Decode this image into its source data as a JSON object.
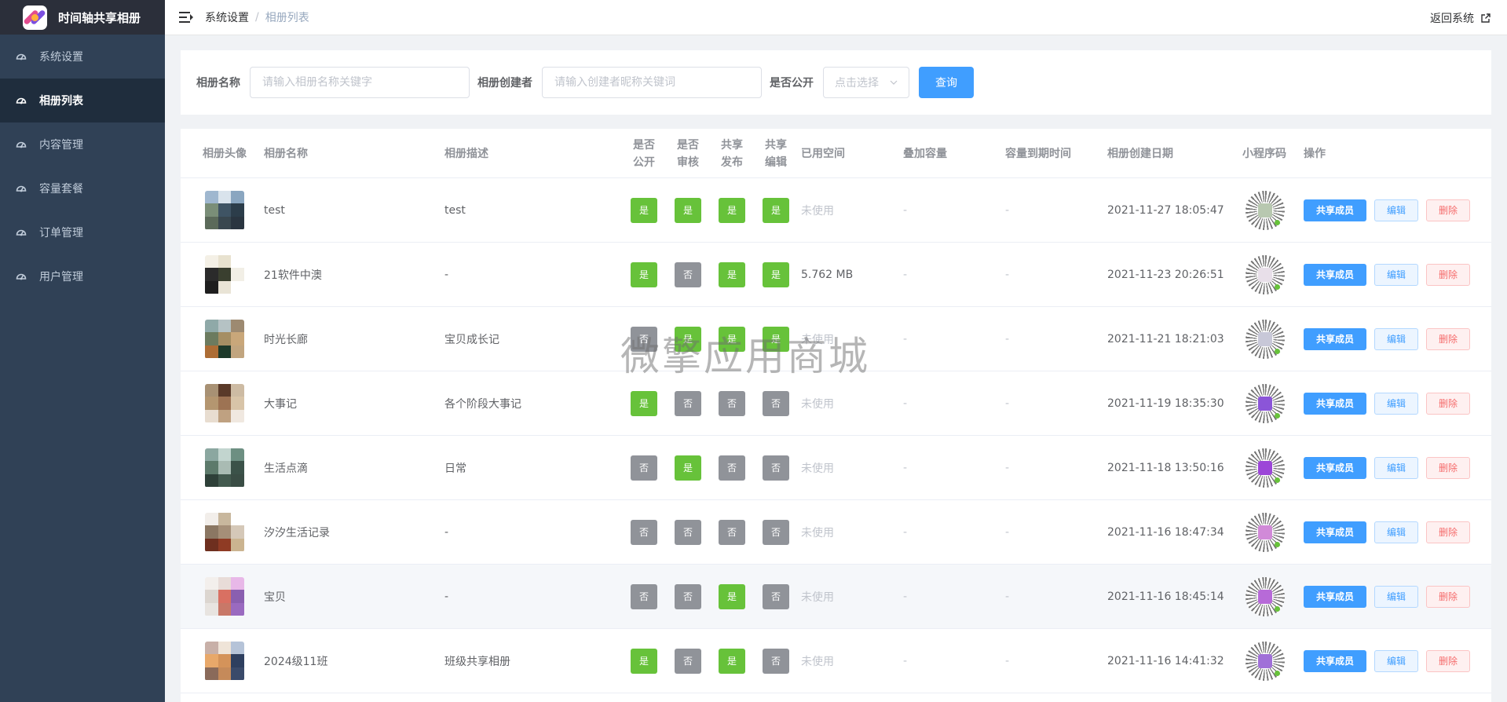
{
  "app": {
    "title": "时间轴共享相册"
  },
  "sidebar": {
    "items": [
      {
        "label": "系统设置",
        "icon": "dashboard-icon"
      },
      {
        "label": "相册列表",
        "icon": "dashboard-icon",
        "active": true
      },
      {
        "label": "内容管理",
        "icon": "dashboard-icon"
      },
      {
        "label": "容量套餐",
        "icon": "dashboard-icon"
      },
      {
        "label": "订单管理",
        "icon": "dashboard-icon"
      },
      {
        "label": "用户管理",
        "icon": "dashboard-icon"
      }
    ]
  },
  "header": {
    "breadcrumb": [
      "系统设置",
      "相册列表"
    ],
    "return_label": "返回系统"
  },
  "search": {
    "name_label": "相册名称",
    "name_placeholder": "请输入相册名称关键字",
    "creator_label": "相册创建者",
    "creator_placeholder": "请输入创建者昵称关键词",
    "public_label": "是否公开",
    "public_placeholder": "点击选择",
    "query_button": "查询"
  },
  "table": {
    "headers": {
      "avatar": "相册头像",
      "name": "相册名称",
      "desc": "相册描述",
      "public_1": "是否",
      "public_2": "公开",
      "review_1": "是否",
      "review_2": "审核",
      "share_pub_1": "共享",
      "share_pub_2": "发布",
      "share_edit_1": "共享",
      "share_edit_2": "编辑",
      "used": "已用空间",
      "extra": "叠加容量",
      "expire": "容量到期时间",
      "created": "相册创建日期",
      "qr": "小程序码",
      "ops": "操作"
    },
    "button_labels": {
      "share": "共享成员",
      "edit": "编辑",
      "delete": "删除"
    },
    "rows": [
      {
        "name": "test",
        "desc": "test",
        "public": "是",
        "review": "是",
        "share_pub": "是",
        "share_edit": "是",
        "used": "未使用",
        "extra": "-",
        "expire": "-",
        "created": "2021-11-27 18:05:47",
        "thumb_colors": [
          "#9fb7cf",
          "#d9e3ec",
          "#8aa6c0",
          "#7a8e78",
          "#3f5464",
          "#2c3d4a",
          "#5b6a5a",
          "#39474f",
          "#2a3540"
        ],
        "qr_center": "#b8c8b0"
      },
      {
        "name": "21软件中澳",
        "desc": "-",
        "public": "是",
        "review": "否",
        "share_pub": "是",
        "share_edit": "是",
        "used": "5.762 MB",
        "extra": "-",
        "expire": "-",
        "created": "2021-11-23 20:26:51",
        "thumb_colors": [
          "#f4f0e6",
          "#e8e2cf",
          "#ffffff",
          "#2b2b2b",
          "#3a3f2f",
          "#f2efe6",
          "#1e1e1e",
          "#e9e4d6",
          "#ffffff"
        ],
        "qr_center": "#e8dfe9"
      },
      {
        "name": "时光长廊",
        "desc": "宝贝成长记",
        "public": "否",
        "review": "是",
        "share_pub": "是",
        "share_edit": "是",
        "used": "未使用",
        "extra": "-",
        "expire": "-",
        "created": "2021-11-21 18:21:03",
        "thumb_colors": [
          "#8fa9a8",
          "#b5c2c4",
          "#9d8a71",
          "#6c7b5f",
          "#a58e63",
          "#c9a77a",
          "#ad6d35",
          "#1d3a2a",
          "#c1a57f"
        ],
        "qr_center": "#c8c8d8"
      },
      {
        "name": "大事记",
        "desc": "各个阶段大事记",
        "public": "是",
        "review": "否",
        "share_pub": "否",
        "share_edit": "否",
        "used": "未使用",
        "extra": "-",
        "expire": "-",
        "created": "2021-11-19 18:35:30",
        "thumb_colors": [
          "#a89174",
          "#5a3a29",
          "#cdbba3",
          "#b49670",
          "#9d7353",
          "#d8c4a8",
          "#e8ddd0",
          "#bfa181",
          "#f0e8e0"
        ],
        "qr_center": "#8b55d8"
      },
      {
        "name": "生活点滴",
        "desc": "日常",
        "public": "否",
        "review": "是",
        "share_pub": "否",
        "share_edit": "否",
        "used": "未使用",
        "extra": "-",
        "expire": "-",
        "created": "2021-11-18 13:50:16",
        "thumb_colors": [
          "#8ba7a0",
          "#c2d5cf",
          "#6d8f82",
          "#5d7a6b",
          "#a9bbb3",
          "#3b5249",
          "#2e4038",
          "#435a4f",
          "#3a4d45"
        ],
        "qr_center": "#9c46d8"
      },
      {
        "name": "汐汐生活记录",
        "desc": "-",
        "public": "否",
        "review": "否",
        "share_pub": "否",
        "share_edit": "否",
        "used": "未使用",
        "extra": "-",
        "expire": "-",
        "created": "2021-11-16 18:47:34",
        "thumb_colors": [
          "#f2eeea",
          "#c8b79d",
          "#ffffff",
          "#8b7763",
          "#a58f78",
          "#d5c8b8",
          "#6e2f1f",
          "#8f3b24",
          "#cbb490"
        ],
        "qr_center": "#d18ad8"
      },
      {
        "name": "宝贝",
        "desc": "-",
        "public": "否",
        "review": "否",
        "share_pub": "是",
        "share_edit": "否",
        "used": "未使用",
        "extra": "-",
        "expire": "-",
        "created": "2021-11-16 18:45:14",
        "thumb_colors": [
          "#f3efec",
          "#e8dcd8",
          "#e8b8e8",
          "#dcd6d0",
          "#d97062",
          "#8a5fb0",
          "#e8e4e0",
          "#c87868",
          "#9a6ac0"
        ],
        "qr_center": "#b76ad8"
      },
      {
        "name": "2024级11班",
        "desc": "班级共享相册",
        "public": "是",
        "review": "否",
        "share_pub": "是",
        "share_edit": "否",
        "used": "未使用",
        "extra": "-",
        "expire": "-",
        "created": "2021-11-16 14:41:32",
        "thumb_colors": [
          "#c8b0a8",
          "#efe4d8",
          "#b5c3d8",
          "#e8a86a",
          "#d4935a",
          "#2e3f5f",
          "#8a6a5a",
          "#c58a5a",
          "#3a4a6a"
        ],
        "qr_center": "#a070d8"
      }
    ]
  },
  "watermark": "微擎应用商城",
  "colors": {
    "sidebar_bg": "#304156",
    "primary": "#409eff",
    "success": "#67c23a",
    "info": "#909399",
    "danger": "#f56c6c"
  }
}
